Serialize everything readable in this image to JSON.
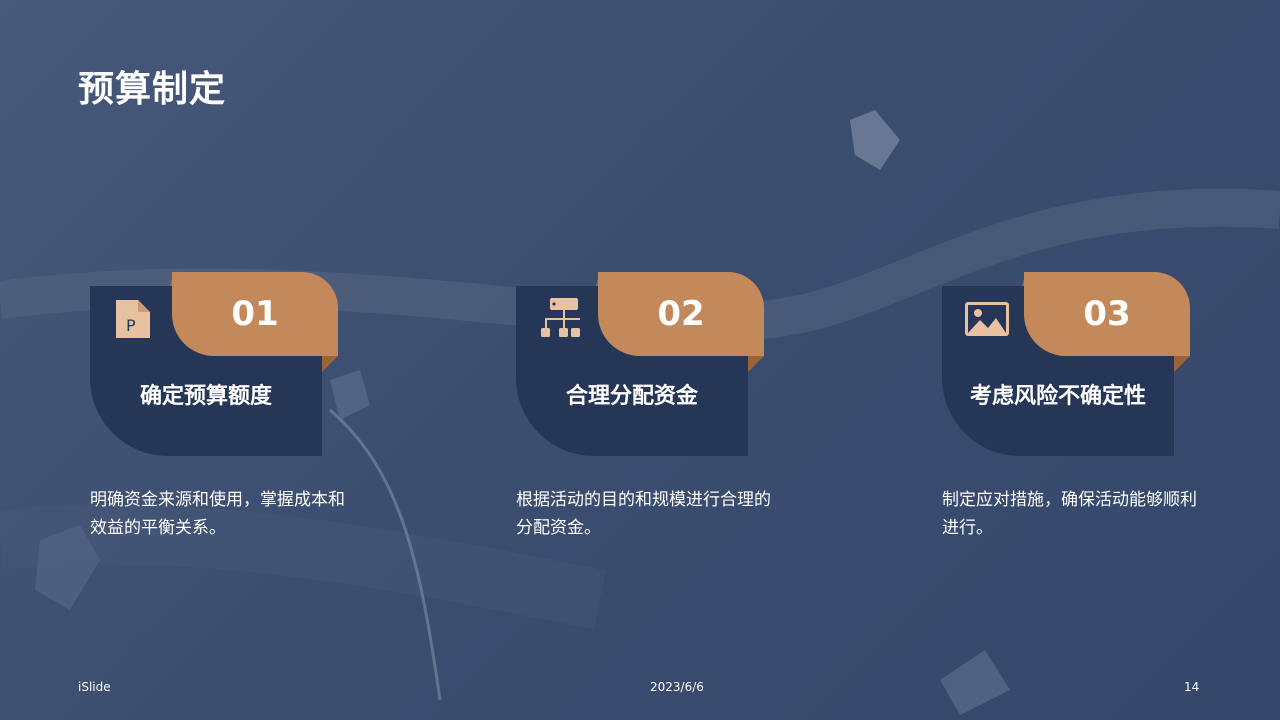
{
  "slide": {
    "title": "预算制定",
    "cards": [
      {
        "number": "01",
        "heading": "确定预算额度",
        "description": "明确资金来源和使用，掌握成本和效益的平衡关系。",
        "icon": "document-p-icon"
      },
      {
        "number": "02",
        "heading": "合理分配资金",
        "description": "根据活动的目的和规模进行合理的分配资金。",
        "icon": "hierarchy-chart-icon"
      },
      {
        "number": "03",
        "heading": "考虑风险不确定性",
        "description": "制定应对措施，确保活动能够顺利进行。",
        "icon": "image-icon"
      }
    ]
  },
  "footer": {
    "brand": "iSlide",
    "date": "2023/6/6",
    "page": "14"
  },
  "colors": {
    "background": "#3c4e70",
    "card_base": "#263657",
    "accent": "#c4895a",
    "icon": "#e8c2a0"
  }
}
